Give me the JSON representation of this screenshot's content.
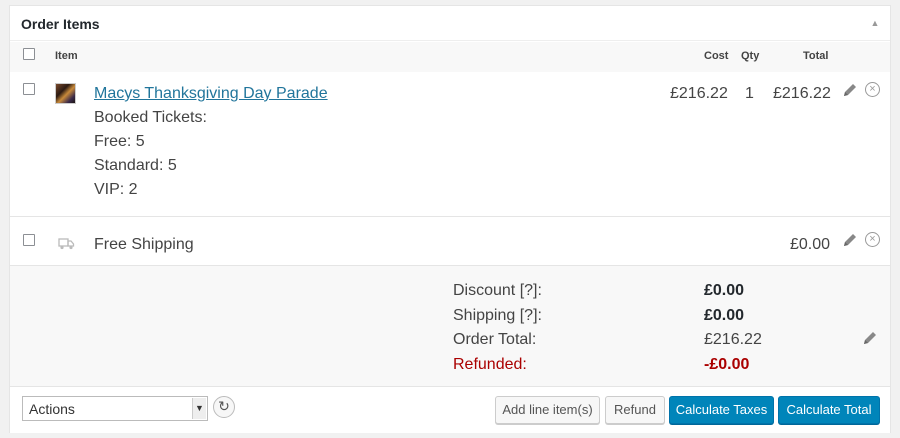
{
  "panel": {
    "title": "Order Items"
  },
  "columns": {
    "item": "Item",
    "cost": "Cost",
    "qty": "Qty",
    "total": "Total"
  },
  "line_item": {
    "name": "Macys Thanksgiving Day Parade",
    "meta": [
      "Booked Tickets:",
      "Free: 5",
      "Standard: 5",
      "VIP: 2"
    ],
    "cost": "£216.22",
    "qty": "1",
    "total": "£216.22"
  },
  "shipping_item": {
    "name": "Free Shipping",
    "total": "£0.00"
  },
  "totals": {
    "discount_label": "Discount [?]:",
    "discount_value": "£0.00",
    "shipping_label": "Shipping [?]:",
    "shipping_value": "£0.00",
    "order_total_label": "Order Total:",
    "order_total_value": "£216.22",
    "refunded_label": "Refunded:",
    "refunded_value": "-£0.00"
  },
  "footer": {
    "actions_selected": "Actions",
    "add_line_items": "Add line item(s)",
    "refund": "Refund",
    "calculate_taxes": "Calculate Taxes",
    "calculate_total": "Calculate Total"
  },
  "colors": {
    "link": "#21759b",
    "primary_button": "#0085ba",
    "refunded": "#aa0000"
  },
  "icons": {
    "collapse": "triangle-up-icon",
    "edit": "pencil-icon",
    "delete": "close-circle-icon",
    "shipping": "truck-icon",
    "refresh": "refresh-icon"
  }
}
